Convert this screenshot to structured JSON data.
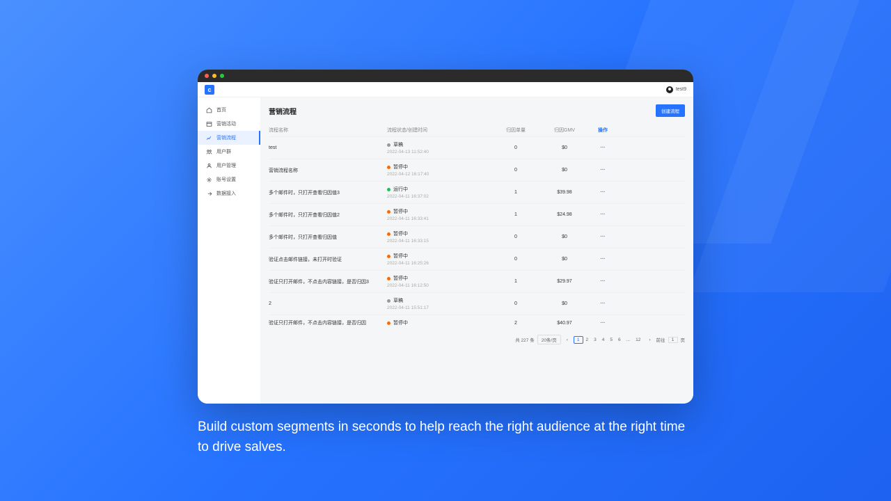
{
  "caption": "Build custom segments in seconds to help reach the right audience at the right time to drive salves.",
  "header": {
    "username": "test9"
  },
  "sidebar": {
    "items": [
      {
        "label": "首页"
      },
      {
        "label": "营销活动"
      },
      {
        "label": "营销流程"
      },
      {
        "label": "用户群"
      },
      {
        "label": "用户管理"
      },
      {
        "label": "账号设置"
      },
      {
        "label": "数据接入"
      }
    ],
    "activeIndex": 2
  },
  "page": {
    "title": "营销流程",
    "create_button": "创建流程"
  },
  "table": {
    "headers": {
      "name": "流程名称",
      "status": "流程状态/创建时间",
      "qty": "归因单量",
      "gmv": "归因GMV",
      "op": "操作"
    },
    "rows": [
      {
        "name": "test",
        "status": "草稿",
        "status_color": "#999",
        "time": "2022-04-13 11:52:40",
        "qty": "0",
        "gmv": "$0"
      },
      {
        "name": "营销流程名称",
        "status": "暂停中",
        "status_color": "#ff6a00",
        "time": "2022-04-12 16:17:40",
        "qty": "0",
        "gmv": "$0"
      },
      {
        "name": "多个邮件时，只打开查看归因值3",
        "status": "运行中",
        "status_color": "#1dbf5e",
        "time": "2022-04-11 16:37:02",
        "qty": "1",
        "gmv": "$39.98"
      },
      {
        "name": "多个邮件时，只打开查看归因值2",
        "status": "暂停中",
        "status_color": "#ff6a00",
        "time": "2022-04-11 16:33:41",
        "qty": "1",
        "gmv": "$24.98"
      },
      {
        "name": "多个邮件时，只打开查看归因值",
        "status": "暂停中",
        "status_color": "#ff6a00",
        "time": "2022-04-11 16:33:15",
        "qty": "0",
        "gmv": "$0"
      },
      {
        "name": "验证点击邮件链接，未打开时验证",
        "status": "暂停中",
        "status_color": "#ff6a00",
        "time": "2022-04-11 16:25:26",
        "qty": "0",
        "gmv": "$0"
      },
      {
        "name": "验证只打开邮件，不点击内容链接，是否归因3",
        "status": "暂停中",
        "status_color": "#ff6a00",
        "time": "2022-04-11 16:12:50",
        "qty": "1",
        "gmv": "$29.97"
      },
      {
        "name": "2",
        "status": "草稿",
        "status_color": "#999",
        "time": "2022-04-11 15:51:17",
        "qty": "0",
        "gmv": "$0"
      },
      {
        "name": "验证只打开邮件，不点击内容链接，是否归因",
        "status": "暂停中",
        "status_color": "#ff6a00",
        "time": "",
        "qty": "2",
        "gmv": "$40.97"
      }
    ]
  },
  "pagination": {
    "total_label": "共 227 条",
    "page_size": "20条/页",
    "pages": [
      "1",
      "2",
      "3",
      "4",
      "5",
      "6",
      "...",
      "12"
    ],
    "current": "1",
    "jump_label": "前往",
    "jump_value": "1",
    "jump_suffix": "页"
  }
}
